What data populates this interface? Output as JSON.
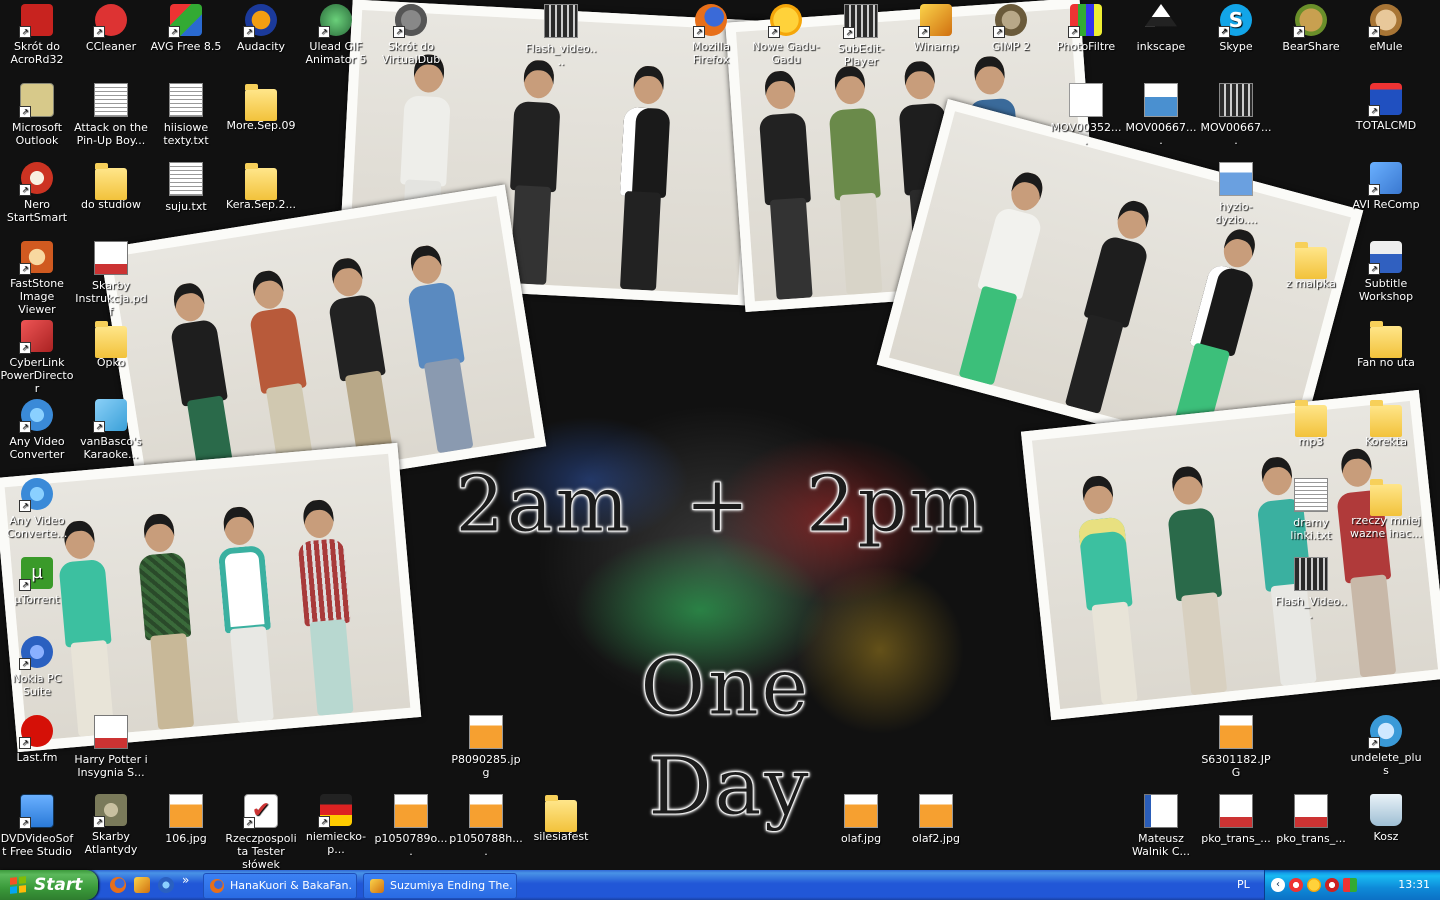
{
  "wallpaper": {
    "title_line1": "2am  +  2pm",
    "title_line2": "One",
    "title_line3": "Day"
  },
  "icons": [
    {
      "id": "acrord32",
      "label": "Skrót do AcroRd32",
      "icon": "acrobat-icon",
      "color": "#c8231f"
    },
    {
      "id": "ccleaner",
      "label": "CCleaner",
      "icon": "ccleaner-icon",
      "color": "#d33"
    },
    {
      "id": "avg",
      "label": "AVG Free 8.5",
      "icon": "avg-icon",
      "color": "#2a6ad1"
    },
    {
      "id": "audacity",
      "label": "Audacity",
      "icon": "audacity-icon",
      "color": "#f29e12"
    },
    {
      "id": "ulead",
      "label": "Ulead GIF Animator 5",
      "icon": "ulead-icon",
      "color": "#3a9b4b"
    },
    {
      "id": "virtualdub",
      "label": "Skrót do VirtualDub",
      "icon": "virtualdub-icon",
      "color": "#777"
    },
    {
      "id": "flashvideo1",
      "label": "Flash_video....",
      "icon": "video-icon",
      "color": "#888"
    },
    {
      "id": "firefox",
      "label": "Mozilla Firefox",
      "icon": "firefox-icon",
      "color": "#e76f1a"
    },
    {
      "id": "gadugadu",
      "label": "Nowe Gadu-Gadu",
      "icon": "gadugadu-icon",
      "color": "#f5a60a"
    },
    {
      "id": "subedit",
      "label": "SubEdit-Player",
      "icon": "subedit-icon",
      "color": "#888"
    },
    {
      "id": "winamp",
      "label": "Winamp",
      "icon": "winamp-icon",
      "color": "#f0a020"
    },
    {
      "id": "gimp",
      "label": "GIMP 2",
      "icon": "gimp-icon",
      "color": "#8a7a5a"
    },
    {
      "id": "photofiltre",
      "label": "PhotoFiltre",
      "icon": "photofiltre-icon",
      "color": "#e33"
    },
    {
      "id": "inkscape",
      "label": "inkscape",
      "icon": "inkscape-icon",
      "color": "#222"
    },
    {
      "id": "skype",
      "label": "Skype",
      "icon": "skype-icon",
      "color": "#12a5e8"
    },
    {
      "id": "bearshare",
      "label": "BearShare",
      "icon": "bearshare-icon",
      "color": "#6a8f2a"
    },
    {
      "id": "emule",
      "label": "eMule",
      "icon": "emule-icon",
      "color": "#a87535"
    },
    {
      "id": "outlook",
      "label": "Microsoft Outlook",
      "icon": "outlook-icon",
      "color": "#d7c98a"
    },
    {
      "id": "attackpinup",
      "label": "Attack on the Pin-Up Boy...",
      "icon": "text-file-icon",
      "color": "#fff"
    },
    {
      "id": "hiisiowe",
      "label": "hiisiowe texty.txt",
      "icon": "text-file-icon",
      "color": "#fff"
    },
    {
      "id": "moresep",
      "label": "More.Sep.09",
      "icon": "folder-icon",
      "color": "#f2c23b"
    },
    {
      "id": "mov1",
      "label": "MOV00352....",
      "icon": "video-file-icon",
      "color": "#fff"
    },
    {
      "id": "mov2",
      "label": "MOV00667....",
      "icon": "video-file-icon",
      "color": "#fff"
    },
    {
      "id": "mov3",
      "label": "MOV00667....",
      "icon": "video-file-icon",
      "color": "#fff"
    },
    {
      "id": "totalcmd",
      "label": "TOTALCMD",
      "icon": "totalcmd-icon",
      "color": "#2050c0"
    },
    {
      "id": "nero",
      "label": "Nero StartSmart",
      "icon": "nero-icon",
      "color": "#c32"
    },
    {
      "id": "dostudiow",
      "label": "do studiow",
      "icon": "folder-icon",
      "color": "#f2c23b"
    },
    {
      "id": "suju",
      "label": "suju.txt",
      "icon": "text-file-icon",
      "color": "#fff"
    },
    {
      "id": "kerasep",
      "label": "Kera.Sep.2...",
      "icon": "folder-icon",
      "color": "#f2c23b"
    },
    {
      "id": "hyzio",
      "label": "hyzio-dyzio....",
      "icon": "image-file-icon",
      "color": "#fff"
    },
    {
      "id": "avirecomp",
      "label": "AVI ReComp",
      "icon": "avirecomp-icon",
      "color": "#3a78d0"
    },
    {
      "id": "faststone",
      "label": "FastStone Image Viewer",
      "icon": "faststone-icon",
      "color": "#d05a20"
    },
    {
      "id": "skarbypdf",
      "label": "Skarby Instrukcja.pdf",
      "icon": "pdf-icon",
      "color": "#fff"
    },
    {
      "id": "zmalpka",
      "label": "z malpka",
      "icon": "folder-icon",
      "color": "#f2c23b"
    },
    {
      "id": "subtitlews",
      "label": "Subtitle Workshop",
      "icon": "subtitle-workshop-icon",
      "color": "#3060c0"
    },
    {
      "id": "cyberlink",
      "label": "CyberLink PowerDirector",
      "icon": "powerdirector-icon",
      "color": "#c33"
    },
    {
      "id": "opko",
      "label": "Opko",
      "icon": "folder-icon",
      "color": "#f2c23b"
    },
    {
      "id": "fannouta",
      "label": "Fan no uta",
      "icon": "folder-icon",
      "color": "#f2c23b"
    },
    {
      "id": "anyvideo1",
      "label": "Any Video Converter",
      "icon": "anyvideo-icon",
      "color": "#3a8ad8"
    },
    {
      "id": "vanbasco",
      "label": "vanBasco's Karaoke...",
      "icon": "vanbasco-icon",
      "color": "#3aa0d8"
    },
    {
      "id": "mp3",
      "label": "mp3",
      "icon": "folder-icon",
      "color": "#f2c23b"
    },
    {
      "id": "korekta",
      "label": "Korekta",
      "icon": "folder-icon",
      "color": "#f2c23b"
    },
    {
      "id": "anyvideo2",
      "label": "Any Video Converte...",
      "icon": "anyvideo-icon",
      "color": "#3a8ad8"
    },
    {
      "id": "dramylinki",
      "label": "dramy linki.txt",
      "icon": "text-file-icon",
      "color": "#fff"
    },
    {
      "id": "rzeczy",
      "label": "rzeczy mniej wazne inac...",
      "icon": "folder-icon",
      "color": "#f2c23b"
    },
    {
      "id": "utorrent",
      "label": "µTorrent",
      "icon": "utorrent-icon",
      "color": "#3a9a2a"
    },
    {
      "id": "flashvideo2",
      "label": "Flash_Video...",
      "icon": "video-icon",
      "color": "#888"
    },
    {
      "id": "nokia",
      "label": "Nokia PC Suite",
      "icon": "nokia-icon",
      "color": "#2a60c0"
    },
    {
      "id": "lastfm",
      "label": "Last.fm",
      "icon": "lastfm-icon",
      "color": "#d51007"
    },
    {
      "id": "harrypotter",
      "label": "Harry Potter i Insygnia S...",
      "icon": "pdf-icon",
      "color": "#fff"
    },
    {
      "id": "p8090285",
      "label": "P8090285.jpg",
      "icon": "image-file-icon",
      "color": "#fff"
    },
    {
      "id": "s6301182",
      "label": "S6301182.JPG",
      "icon": "image-file-icon",
      "color": "#fff"
    },
    {
      "id": "undelete",
      "label": "undelete_plus",
      "icon": "undelete-icon",
      "color": "#3a9ad8"
    },
    {
      "id": "dvdvideosoft",
      "label": "DVDVideoSoft Free Studio",
      "icon": "dvdvideosoft-icon",
      "color": "#2a7ad8"
    },
    {
      "id": "skarbyatl",
      "label": "Skarby Atlantydy",
      "icon": "game-icon",
      "color": "#7a7a5a"
    },
    {
      "id": "106jpg",
      "label": "106.jpg",
      "icon": "image-file-icon",
      "color": "#fff"
    },
    {
      "id": "rzeczpospolita",
      "label": "Rzeczpospolita Tester słówek",
      "icon": "tester-icon",
      "color": "#c33"
    },
    {
      "id": "niemiecko",
      "label": "niemiecko-p...",
      "icon": "dictionary-icon",
      "color": "#222"
    },
    {
      "id": "p1050789",
      "label": "p1050789o....",
      "icon": "image-file-icon",
      "color": "#fff"
    },
    {
      "id": "p1050788",
      "label": "p1050788h....",
      "icon": "image-file-icon",
      "color": "#fff"
    },
    {
      "id": "silesiafest",
      "label": "silesiafest",
      "icon": "folder-icon",
      "color": "#f2c23b"
    },
    {
      "id": "olaf",
      "label": "olaf.jpg",
      "icon": "image-file-icon",
      "color": "#fff"
    },
    {
      "id": "olaf2",
      "label": "olaf2.jpg",
      "icon": "image-file-icon",
      "color": "#fff"
    },
    {
      "id": "mateusz",
      "label": "Mateusz Walnik C...",
      "icon": "word-doc-icon",
      "color": "#fff"
    },
    {
      "id": "pkotrans1",
      "label": "pko_trans_...",
      "icon": "pdf-icon",
      "color": "#fff"
    },
    {
      "id": "pkotrans2",
      "label": "pko_trans_...",
      "icon": "pdf-icon",
      "color": "#fff"
    },
    {
      "id": "kosz",
      "label": "Kosz",
      "icon": "recycle-bin-icon",
      "color": "#9fbfd4"
    }
  ],
  "taskbar": {
    "start_label": "Start",
    "quick_launch_more": "»",
    "tasks": [
      {
        "label": "HanaKuori & BakaFan...",
        "icon": "firefox-icon"
      },
      {
        "label": "Suzumiya Ending The...",
        "icon": "subedit-icon"
      }
    ],
    "tray": {
      "language": "PL",
      "clock": "13:31"
    }
  }
}
